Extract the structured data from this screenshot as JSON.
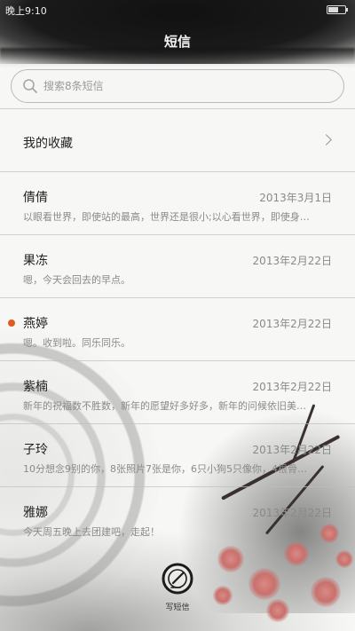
{
  "status_bar": {
    "time": "晚上9:10",
    "battery_level": 0.6
  },
  "header": {
    "title": "短信"
  },
  "search": {
    "placeholder": "搜索8条短信",
    "icon": "search-icon"
  },
  "favorites": {
    "label": "我的收藏"
  },
  "messages": [
    {
      "name": "倩倩",
      "date": "2013年3月1日",
      "preview": "以眼看世界，即使站的最高，世界还是很小;以心看世界，即使身…",
      "unread": false
    },
    {
      "name": "果冻",
      "date": "2013年2月22日",
      "preview": "嗯，今天会回去的早点。",
      "unread": false
    },
    {
      "name": "燕婷",
      "date": "2013年2月22日",
      "preview": "嗯。收到啦。同乐同乐。",
      "unread": true
    },
    {
      "name": "紫楠",
      "date": "2013年2月22日",
      "preview": "新年的祝福数不胜数，新年的愿望好多好多，新年的问候依旧美…",
      "unread": false
    },
    {
      "name": "子玲",
      "date": "2013年2月22日",
      "preview": "10分想念9别的你，8张照片7张是你，6只小狗5只像你，4根骨…",
      "unread": false
    },
    {
      "name": "雅娜",
      "date": "2013年2月22日",
      "preview": "今天周五晚上去团建吧，走起！",
      "unread": false
    }
  ],
  "compose": {
    "label": "写短信",
    "icon": "pen-circle-icon"
  },
  "colors": {
    "accent_unread": "#e35a1e",
    "text_secondary": "#8a8a8a"
  }
}
